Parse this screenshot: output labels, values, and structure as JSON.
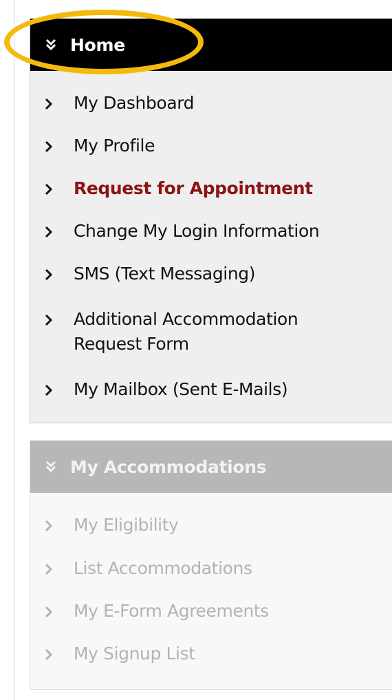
{
  "home": {
    "title": "Home",
    "icon": "double-chevron-down-icon",
    "items": [
      {
        "label": "My Dashboard"
      },
      {
        "label": "My Profile"
      },
      {
        "label": "Request for Appointment",
        "highlighted": true
      },
      {
        "label": "Change My Login Information"
      },
      {
        "label": "SMS (Text Messaging)"
      },
      {
        "label": "Additional Accommodation Request Form"
      },
      {
        "label": "My Mailbox (Sent E-Mails)"
      }
    ]
  },
  "accommodations": {
    "title": "My Accommodations",
    "icon": "double-chevron-down-icon",
    "items": [
      {
        "label": "My Eligibility"
      },
      {
        "label": "List Accommodations"
      },
      {
        "label": "My E-Form Agreements"
      },
      {
        "label": "My Signup List"
      }
    ]
  },
  "colors": {
    "home_header_bg": "#000000",
    "accommodations_header_bg": "#b7b7b7",
    "highlight_text": "#8b1414",
    "focus_ring": "#f5b90e",
    "disabled_text": "#b3b3b3"
  }
}
